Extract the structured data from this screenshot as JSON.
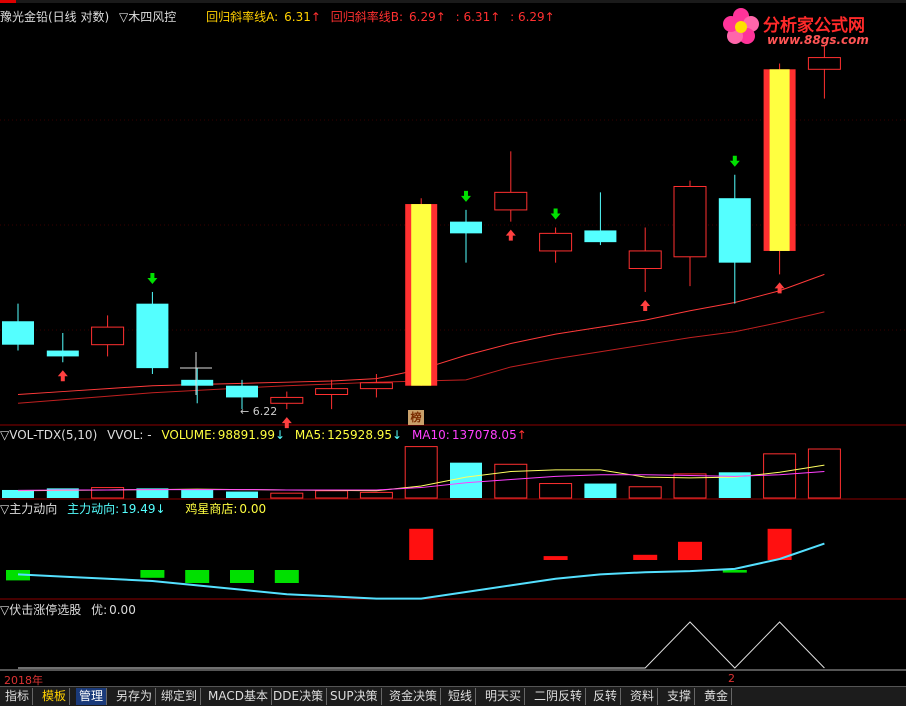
{
  "top_header": {
    "stock": "豫光金铅(日线 对数)",
    "formula": "▽木四风控",
    "regA_label": "回归斜率线A:",
    "regA_value": "6.31",
    "regB_label": "回归斜率线B:",
    "regB_value": "6.29",
    "extra1": ": 6.31",
    "extra2": ": 6.29",
    "up_arrow": "↑",
    "down_arrow": "↓"
  },
  "logo": {
    "text": "分析家公式网",
    "url": "www.88gs.com"
  },
  "price_panel": {
    "low_label": "← 6.22",
    "badge": "榜"
  },
  "vol_header": {
    "name": "▽VOL-TDX(5,10)",
    "vvol": "VVOL: -",
    "volume_label": "VOLUME:",
    "volume_value": "98891.99",
    "ma5_label": "MA5:",
    "ma5_value": "125928.95",
    "ma10_label": "MA10:",
    "ma10_value": "137078.05"
  },
  "main_header": {
    "name": "▽主力动向",
    "label": "主力动向:",
    "value": "19.49",
    "shop_label": "鸡星商店:",
    "shop_value": "0.00"
  },
  "select_header": {
    "name": "▽伏击涨停选股",
    "label": "优:",
    "value": "0.00"
  },
  "axis": {
    "year": "2018年",
    "page": "2"
  },
  "footer_tabs": [
    "指标",
    "模板",
    "管理",
    "另存为",
    "绑定到",
    "MACD基本",
    "DDE决策",
    "SUP决策",
    "资金决策",
    "短线",
    "明天买",
    "二阴反转",
    "反转",
    "资料",
    "支撑",
    "黄金"
  ],
  "colors": {
    "up": "#ff3030",
    "down": "#54ffff",
    "bg": "#000000",
    "frame": "#8b0000",
    "yellow": "#ffff40",
    "green": "#00e000"
  },
  "chart_data": {
    "type": "candlestick",
    "candles": [
      {
        "o": 6.32,
        "c": 6.28,
        "h": 6.35,
        "l": 6.27,
        "sig": ""
      },
      {
        "o": 6.27,
        "c": 6.26,
        "h": 6.3,
        "l": 6.25,
        "sig": "buy"
      },
      {
        "o": 6.28,
        "c": 6.31,
        "h": 6.33,
        "l": 6.26,
        "sig": ""
      },
      {
        "o": 6.35,
        "c": 6.24,
        "h": 6.37,
        "l": 6.23,
        "sig": "sell"
      },
      {
        "o": 6.22,
        "c": 6.21,
        "h": 6.24,
        "l": 6.18,
        "sig": ""
      },
      {
        "o": 6.21,
        "c": 6.19,
        "h": 6.22,
        "l": 6.17,
        "sig": ""
      },
      {
        "o": 6.18,
        "c": 6.19,
        "h": 6.2,
        "l": 6.17,
        "sig": "buy"
      },
      {
        "o": 6.195,
        "c": 6.205,
        "h": 6.22,
        "l": 6.17,
        "sig": ""
      },
      {
        "o": 6.205,
        "c": 6.215,
        "h": 6.23,
        "l": 6.19,
        "sig": ""
      },
      {
        "o": 6.21,
        "c": 6.52,
        "h": 6.53,
        "l": 6.21,
        "sig": "big"
      },
      {
        "o": 6.49,
        "c": 6.47,
        "h": 6.51,
        "l": 6.42,
        "sig": "sell"
      },
      {
        "o": 6.51,
        "c": 6.54,
        "h": 6.61,
        "l": 6.49,
        "sig": "buy"
      },
      {
        "o": 6.44,
        "c": 6.47,
        "h": 6.48,
        "l": 6.42,
        "sig": "sell"
      },
      {
        "o": 6.475,
        "c": 6.455,
        "h": 6.54,
        "l": 6.45,
        "sig": ""
      },
      {
        "o": 6.41,
        "c": 6.44,
        "h": 6.48,
        "l": 6.37,
        "sig": "buy"
      },
      {
        "o": 6.43,
        "c": 6.55,
        "h": 6.56,
        "l": 6.38,
        "sig": ""
      },
      {
        "o": 6.53,
        "c": 6.42,
        "h": 6.57,
        "l": 6.35,
        "sig": "sell"
      },
      {
        "o": 6.44,
        "c": 6.75,
        "h": 6.76,
        "l": 6.4,
        "sig": "bigbuy"
      },
      {
        "o": 6.75,
        "c": 6.77,
        "h": 6.79,
        "l": 6.7,
        "sig": ""
      }
    ],
    "ma_fast": [
      6.195,
      6.2,
      6.205,
      6.21,
      6.212,
      6.214,
      6.216,
      6.218,
      6.222,
      6.238,
      6.262,
      6.282,
      6.298,
      6.31,
      6.322,
      6.338,
      6.352,
      6.372,
      6.4
    ],
    "ma_slow": [
      6.18,
      6.186,
      6.192,
      6.198,
      6.202,
      6.206,
      6.21,
      6.213,
      6.216,
      6.218,
      6.22,
      6.242,
      6.256,
      6.268,
      6.28,
      6.292,
      6.302,
      6.318,
      6.336
    ],
    "volume": [
      1,
      1.2,
      1.3,
      1.2,
      1.1,
      0.8,
      0.6,
      0.9,
      0.7,
      6.4,
      4.4,
      4.2,
      1.8,
      1.8,
      1.4,
      3,
      3.2,
      5.5,
      6.1
    ],
    "vol_ma5": [
      0.9,
      0.95,
      1,
      1.05,
      1.1,
      1.05,
      1,
      0.95,
      0.9,
      1.5,
      2.6,
      3.3,
      3.5,
      3.5,
      2.6,
      2.5,
      2.6,
      3.2,
      4.1
    ],
    "vol_ma10": [
      0.95,
      1,
      1,
      1.05,
      1.05,
      1.05,
      1,
      1,
      1,
      1.3,
      1.9,
      2.3,
      2.7,
      2.9,
      2.9,
      2.8,
      2.7,
      2.9,
      3.3
    ],
    "main_line": [
      -12,
      -13,
      -14,
      -15,
      -17,
      -19,
      -21,
      -22,
      -23,
      -23,
      -20,
      -17,
      -14,
      -12,
      -11,
      -10.5,
      -9.5,
      -5,
      2
    ],
    "main_bars": [
      -4,
      0,
      0,
      -3,
      -5,
      -5,
      -5,
      0,
      0,
      12,
      0,
      0,
      1.5,
      0,
      2,
      7,
      -1,
      12,
      0
    ],
    "select_line": [
      0,
      0,
      0,
      0,
      0,
      0,
      0,
      0,
      0,
      0,
      0,
      0,
      0,
      0,
      0,
      1,
      0,
      1,
      0
    ]
  }
}
